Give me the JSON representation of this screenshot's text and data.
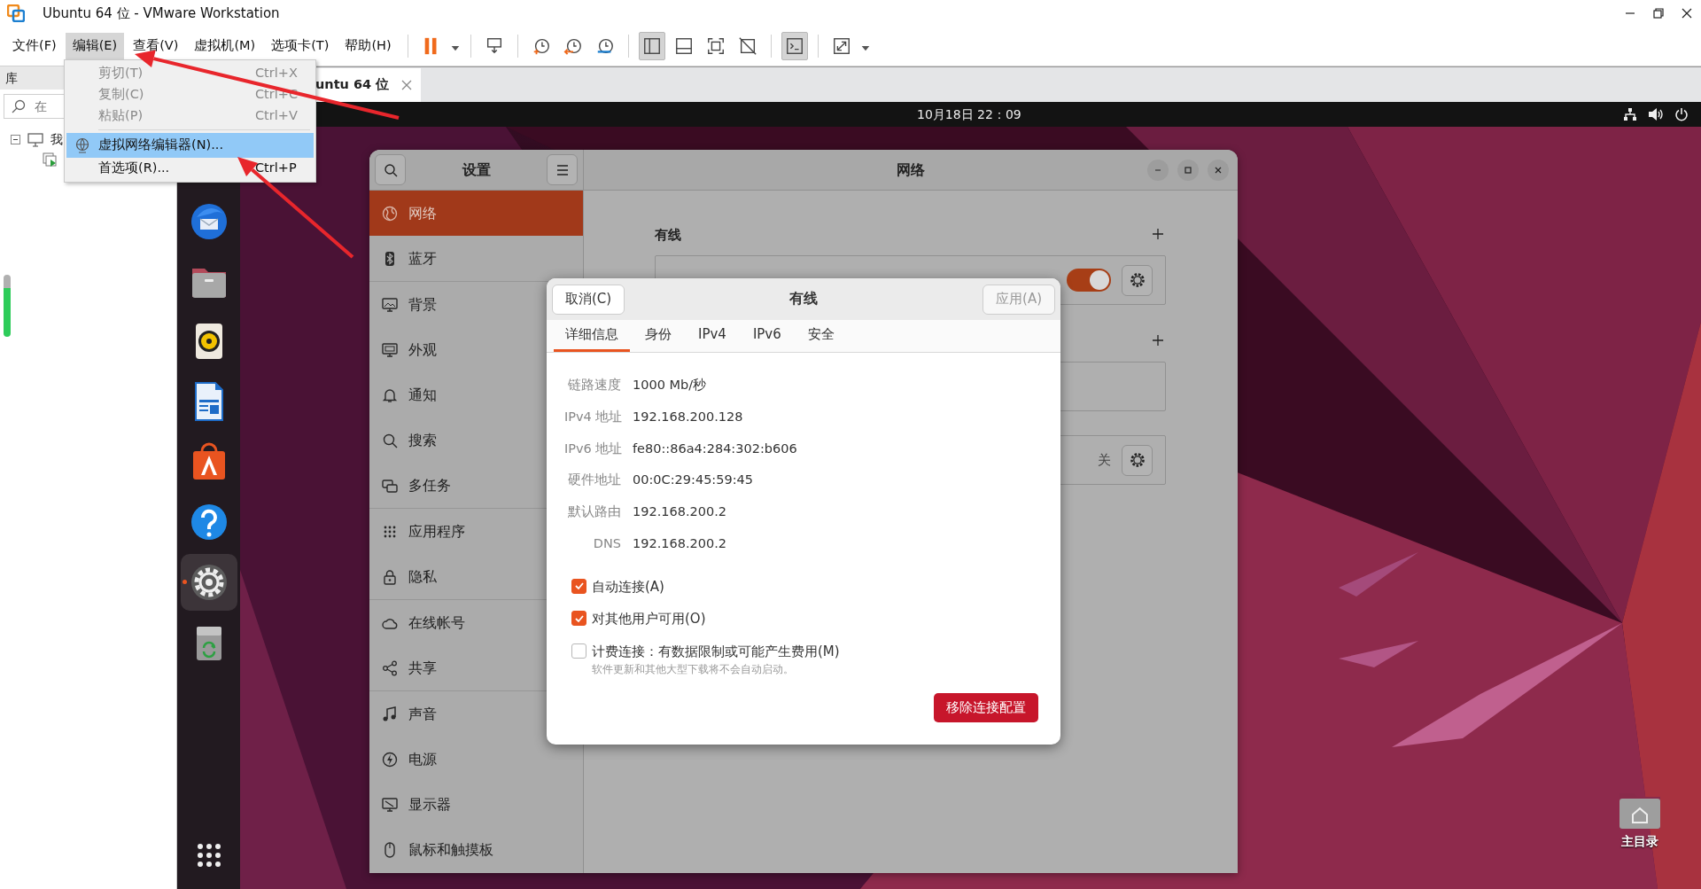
{
  "window": {
    "title": "Ubuntu 64 位 - VMware Workstation"
  },
  "menubar": [
    {
      "label": "文件(F)",
      "selected": false
    },
    {
      "label": "编辑(E)",
      "selected": true
    },
    {
      "label": "查看(V)",
      "selected": false
    },
    {
      "label": "虚拟机(M)",
      "selected": false
    },
    {
      "label": "选项卡(T)",
      "selected": false
    },
    {
      "label": "帮助(H)",
      "selected": false
    }
  ],
  "toolbar": [
    {
      "kind": "pause",
      "selected": false
    },
    {
      "kind": "caret",
      "selected": false
    },
    {
      "kind": "separator"
    },
    {
      "kind": "send-keys",
      "selected": false
    },
    {
      "kind": "separator"
    },
    {
      "kind": "snapshot-take",
      "selected": false
    },
    {
      "kind": "snapshot-revert",
      "selected": false
    },
    {
      "kind": "snapshot-manage",
      "selected": false
    },
    {
      "kind": "separator"
    },
    {
      "kind": "view-library",
      "selected": true
    },
    {
      "kind": "view-thumbnail",
      "selected": false
    },
    {
      "kind": "view-full",
      "selected": false
    },
    {
      "kind": "view-unity",
      "selected": false
    },
    {
      "kind": "separator"
    },
    {
      "kind": "console",
      "selected": true
    },
    {
      "kind": "separator"
    },
    {
      "kind": "fullscreen",
      "selected": false
    },
    {
      "kind": "caret",
      "selected": false
    }
  ],
  "edit_menu": [
    {
      "kind": "plain",
      "label": "剪切(T)",
      "shortcut": "Ctrl+X",
      "disabled": true,
      "selected": false
    },
    {
      "kind": "plain",
      "label": "复制(C)",
      "shortcut": "Ctrl+C",
      "disabled": true,
      "selected": false
    },
    {
      "kind": "plain",
      "label": "粘贴(P)",
      "shortcut": "Ctrl+V",
      "disabled": true,
      "selected": false
    },
    {
      "kind": "separator"
    },
    {
      "kind": "network",
      "label": "虚拟网络编辑器(N)...",
      "disabled": false,
      "selected": true
    },
    {
      "kind": "plain",
      "label": "首选项(R)...",
      "shortcut": "Ctrl+P",
      "disabled": false,
      "selected": false
    }
  ],
  "library": {
    "title": "库",
    "search_placeholder": "在",
    "tree": [
      {
        "label": "我",
        "expanded": true
      }
    ]
  },
  "vm_tabs": [
    {
      "label": "untu 64 位",
      "selected": true
    }
  ],
  "guest": {
    "clock": "10月18日  22：09",
    "dock": [
      {
        "kind": "thunderbird",
        "selected": false
      },
      {
        "kind": "files",
        "selected": false
      },
      {
        "kind": "rhythmbox",
        "selected": false
      },
      {
        "kind": "writer",
        "selected": false
      },
      {
        "kind": "appcenter",
        "selected": false
      },
      {
        "kind": "help",
        "selected": false
      },
      {
        "kind": "settings",
        "selected": true
      },
      {
        "kind": "trash",
        "selected": false
      }
    ],
    "settings": {
      "title": "设置",
      "panel_title": "网络",
      "sidebar": [
        [
          {
            "label": "网络",
            "kind": "network",
            "selected": true
          },
          {
            "label": "蓝牙",
            "kind": "bluetooth",
            "selected": false
          }
        ],
        [
          {
            "label": "背景",
            "kind": "background",
            "selected": false
          },
          {
            "label": "外观",
            "kind": "appearance",
            "selected": false
          },
          {
            "label": "通知",
            "kind": "notifications",
            "selected": false
          },
          {
            "label": "搜索",
            "kind": "search",
            "selected": false
          },
          {
            "label": "多任务",
            "kind": "multitask",
            "selected": false
          }
        ],
        [
          {
            "label": "应用程序",
            "kind": "apps",
            "selected": false
          },
          {
            "label": "隐私",
            "kind": "privacy",
            "selected": false
          }
        ],
        [
          {
            "label": "在线帐号",
            "kind": "online",
            "selected": false
          },
          {
            "label": "共享",
            "kind": "sharing",
            "selected": false
          }
        ],
        [
          {
            "label": "声音",
            "kind": "sound",
            "selected": false
          },
          {
            "label": "电源",
            "kind": "power",
            "selected": false
          },
          {
            "label": "显示器",
            "kind": "displays",
            "selected": false
          },
          {
            "label": "鼠标和触摸板",
            "kind": "mouse",
            "selected": false
          }
        ]
      ],
      "sections": [
        {
          "heading": "有线",
          "addable": true,
          "cards": [
            {
              "kind": "toggle",
              "on": true
            }
          ]
        },
        {
          "addable": true,
          "cards": [
            {
              "kind": "empty"
            }
          ]
        },
        {
          "addable": false,
          "cards": [
            {
              "kind": "status",
              "status": "关"
            }
          ]
        }
      ]
    },
    "dialog": {
      "title": "有线",
      "cancel": "取消(C)",
      "apply": {
        "label": "应用(A)",
        "disabled": true
      },
      "tabs": [
        {
          "label": "详细信息",
          "selected": true
        },
        {
          "label": "身份",
          "selected": false
        },
        {
          "label": "IPv4",
          "selected": false
        },
        {
          "label": "IPv6",
          "selected": false
        },
        {
          "label": "安全",
          "selected": false
        }
      ],
      "details": [
        {
          "label": "链路速度",
          "value": "1000 Mb/秒"
        },
        {
          "label": "IPv4 地址",
          "value": "192.168.200.128"
        },
        {
          "label": "IPv6 地址",
          "value": "fe80::86a4:284:302:b606"
        },
        {
          "label": "硬件地址",
          "value": "00:0C:29:45:59:45"
        },
        {
          "label": "默认路由",
          "value": "192.168.200.2"
        },
        {
          "label": "DNS",
          "value": "192.168.200.2"
        }
      ],
      "options": [
        {
          "label": "自动连接(A)",
          "checked": true
        },
        {
          "label": "对其他用户可用(O)",
          "checked": true
        },
        {
          "label": "计费连接：有数据限制或可能产生费用(M)",
          "hint": "软件更新和其他大型下载将不会自动启动。",
          "checked": false
        }
      ],
      "remove": "移除连接配置"
    },
    "home_label": "主目录"
  },
  "annotations": [
    {
      "kind": "arrow"
    },
    {
      "kind": "arrow"
    }
  ]
}
